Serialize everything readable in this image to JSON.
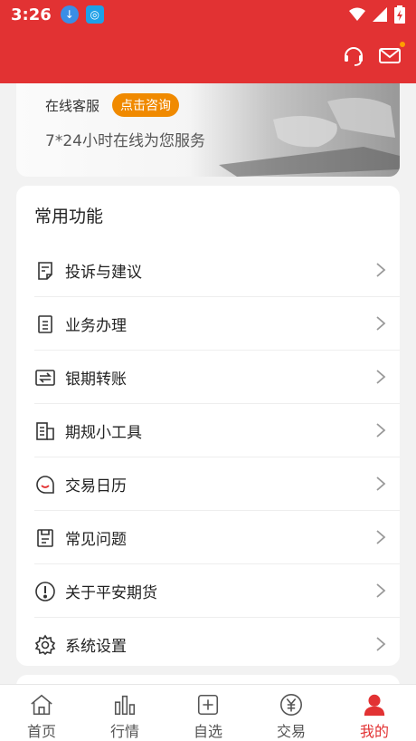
{
  "status_bar": {
    "time": "3:26"
  },
  "service": {
    "label": "在线客服",
    "button": "点击咨询",
    "subtitle": "7*24小时在线为您服务"
  },
  "functions": {
    "title": "常用功能",
    "items": [
      {
        "label": "投诉与建议",
        "icon": "feedback-icon"
      },
      {
        "label": "业务办理",
        "icon": "business-icon"
      },
      {
        "label": "银期转账",
        "icon": "transfer-icon"
      },
      {
        "label": "期规小工具",
        "icon": "tools-icon"
      },
      {
        "label": "交易日历",
        "icon": "calendar-icon"
      },
      {
        "label": "常见问题",
        "icon": "faq-icon"
      },
      {
        "label": "关于平安期货",
        "icon": "about-icon"
      },
      {
        "label": "系统设置",
        "icon": "settings-icon"
      }
    ]
  },
  "tabs": [
    {
      "label": "首页",
      "icon": "home-icon"
    },
    {
      "label": "行情",
      "icon": "market-icon"
    },
    {
      "label": "自选",
      "icon": "watchlist-icon"
    },
    {
      "label": "交易",
      "icon": "trade-icon"
    },
    {
      "label": "我的",
      "icon": "profile-icon",
      "active": true
    }
  ],
  "colors": {
    "brand": "#e23233",
    "accent": "#f08a00"
  }
}
